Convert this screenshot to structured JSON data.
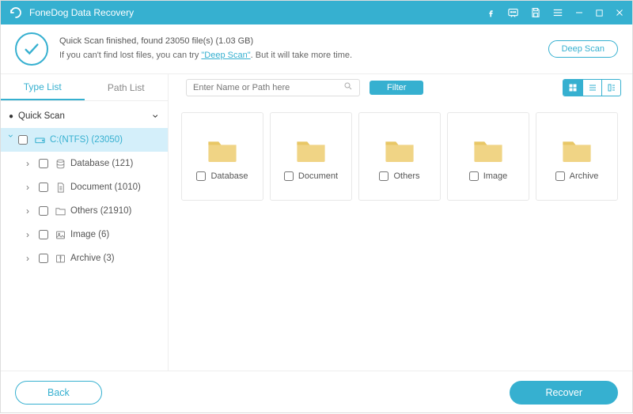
{
  "app": {
    "title": "FoneDog Data Recovery"
  },
  "status": {
    "line1": "Quick Scan finished, found 23050 file(s) (1.03 GB)",
    "line2_pre": "If you can't find lost files, you can try ",
    "line2_link": "\"Deep Scan\"",
    "line2_post": ". But it will take more time.",
    "deep_scan": "Deep Scan"
  },
  "tabs": {
    "type": "Type List",
    "path": "Path List"
  },
  "tree": {
    "root": "Quick Scan",
    "drive": "C:(NTFS) (23050)",
    "items": [
      {
        "label": "Database (121)"
      },
      {
        "label": "Document (1010)"
      },
      {
        "label": "Others (21910)"
      },
      {
        "label": "Image (6)"
      },
      {
        "label": "Archive (3)"
      }
    ]
  },
  "toolbar": {
    "search_placeholder": "Enter Name or Path here",
    "filter": "Filter"
  },
  "grid": {
    "items": [
      {
        "label": "Database"
      },
      {
        "label": "Document"
      },
      {
        "label": "Others"
      },
      {
        "label": "Image"
      },
      {
        "label": "Archive"
      }
    ]
  },
  "footer": {
    "back": "Back",
    "recover": "Recover"
  }
}
